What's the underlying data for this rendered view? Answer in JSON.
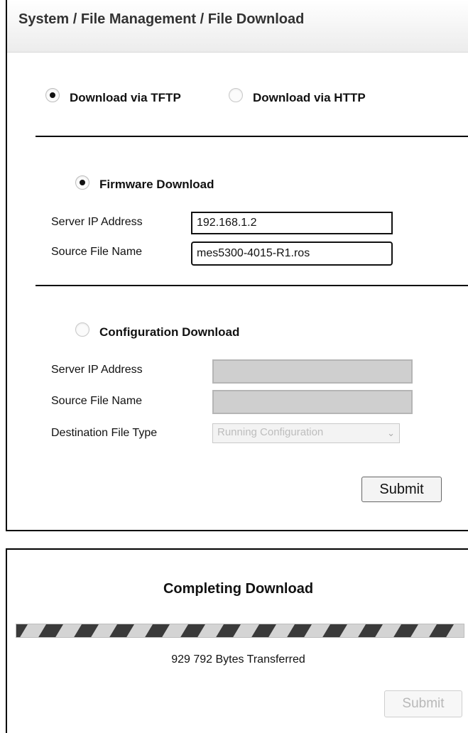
{
  "header": {
    "title": "System / File Management / File Download"
  },
  "method": {
    "options": [
      {
        "label": "Download via TFTP",
        "selected": true
      },
      {
        "label": "Download via HTTP",
        "selected": false
      }
    ]
  },
  "firmware": {
    "label": "Firmware Download",
    "selected": true,
    "server_ip_label": "Server IP Address",
    "server_ip_value": "192.168.1.2",
    "source_file_label": "Source File Name",
    "source_file_value": "mes5300-4015-R1.ros"
  },
  "configuration": {
    "label": "Configuration Download",
    "selected": false,
    "server_ip_label": "Server IP Address",
    "source_file_label": "Source File Name",
    "dest_type_label": "Destination File Type",
    "dest_type_value": "Running Configuration"
  },
  "submit_label": "Submit",
  "progress": {
    "title": "Completing Download",
    "transferred": "929 792 Bytes Transferred",
    "submit_label": "Submit"
  },
  "colors": {
    "stripe_dark": "#3a3a3a",
    "stripe_light": "#d4d4d4"
  },
  "icons": {
    "chevron": "chevron-down-icon"
  }
}
